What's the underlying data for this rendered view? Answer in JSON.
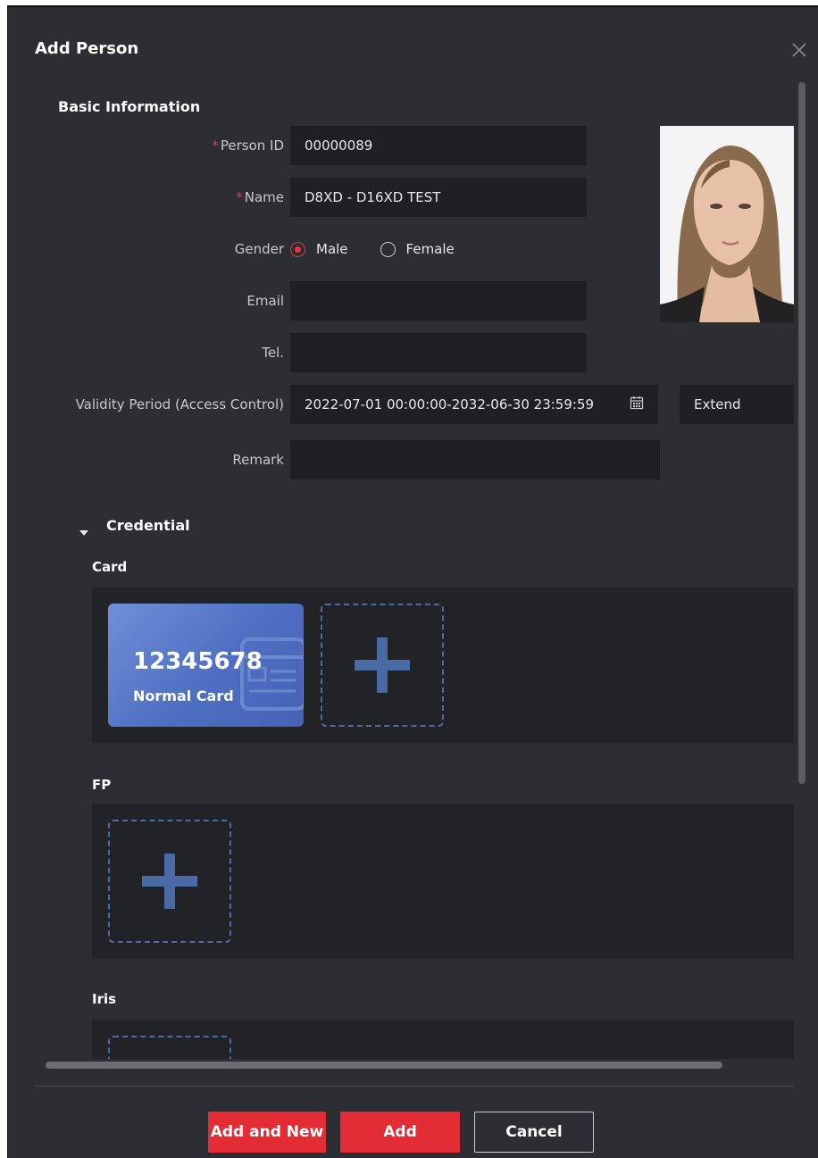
{
  "dialog": {
    "title": "Add Person"
  },
  "basic": {
    "section_title": "Basic Information",
    "person_id_label": "Person ID",
    "person_id_value": "00000089",
    "name_label": "Name",
    "name_value": "D8XD - D16XD TEST",
    "gender_label": "Gender",
    "gender_options": [
      "Male",
      "Female"
    ],
    "gender_selected": "Male",
    "email_label": "Email",
    "email_value": "",
    "tel_label": "Tel.",
    "tel_value": "",
    "validity_label": "Validity Period (Access Control)",
    "validity_value": "2022-07-01 00:00:00-2032-06-30 23:59:59",
    "extend_label": "Extend",
    "remark_label": "Remark",
    "remark_value": "",
    "required_mark": "*"
  },
  "credential": {
    "section_title": "Credential",
    "card_title": "Card",
    "card_number": "12345678",
    "card_type": "Normal Card",
    "fp_title": "FP",
    "iris_title": "Iris"
  },
  "footer": {
    "add_and_new": "Add and New",
    "add": "Add",
    "cancel": "Cancel"
  },
  "colors": {
    "accent_red": "#e32c34",
    "card_blue": "#5a7bcc",
    "panel_bg": "#2c2e33"
  }
}
